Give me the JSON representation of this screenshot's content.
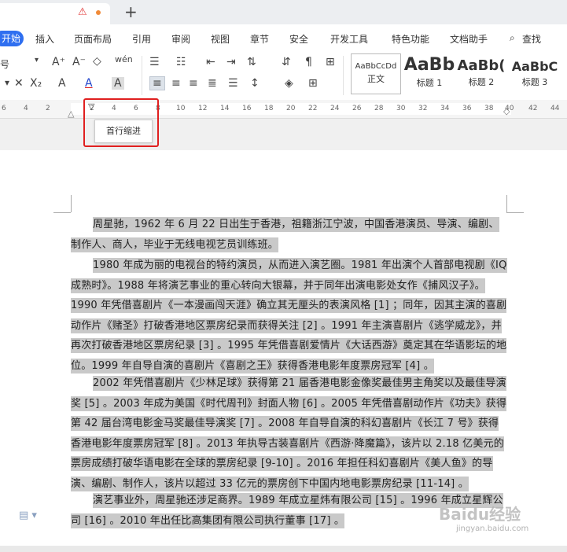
{
  "titlebar": {
    "warn_icon": "warning-icon",
    "new_tab": "+"
  },
  "menu": {
    "start": "开始",
    "items": [
      "插入",
      "页面布局",
      "引用",
      "审阅",
      "视图",
      "章节",
      "安全",
      "开发工具",
      "特色功能",
      "文档助手",
      "查找"
    ]
  },
  "toolbar": {
    "font_size_partial": "号",
    "grow_font": "A⁺",
    "shrink_font": "A⁻",
    "clear_format": "◇",
    "pinyin": "wén",
    "bullets": "☰",
    "numbering": "☷",
    "align_left": "≡",
    "align_center": "≡",
    "align_right": "≡",
    "font_color": "A",
    "highlight": "A"
  },
  "styles": [
    {
      "sample": "AaBbCcDd",
      "name": "正文"
    },
    {
      "sample": "AaBb",
      "name": "标题 1"
    },
    {
      "sample": "AaBb(",
      "name": "标题 2"
    },
    {
      "sample": "AaBbC",
      "name": "标题 3"
    }
  ],
  "ruler": {
    "numbers": [
      "6",
      "4",
      "2",
      "2",
      "4",
      "6",
      "8",
      "10",
      "12",
      "14",
      "16",
      "18",
      "20",
      "22",
      "24",
      "26",
      "28",
      "30",
      "32",
      "34",
      "36",
      "38",
      "40",
      "42",
      "44"
    ]
  },
  "tooltip": {
    "label": "首行缩进"
  },
  "document": {
    "p1": "周星驰，1962 年 6 月 22 日出生于香港，祖籍浙江宁波，中国香港演员、导演、编剧、制作人、商人，毕业于无线电视艺员训练班。",
    "p2": "1980 年成为丽的电视台的特约演员，从而进入演艺圈。1981 年出演个人首部电视剧《IQ 成熟时》。1988 年将演艺事业的重心转向大银幕，并于同年出演电影处女作《捕风汉子》。1990 年凭借喜剧片《一本漫画闯天涯》确立其无厘头的表演风格 [1] ；同年，因其主演的喜剧动作片《赌圣》打破香港地区票房纪录而获得关注 [2] 。1991 年主演喜剧片《逃学威龙》，并再次打破香港地区票房纪录 [3] 。1995 年凭借喜剧爱情片《大话西游》奠定其在华语影坛的地位。1999 年自导自演的喜剧片《喜剧之王》获得香港电影年度票房冠军 [4] 。",
    "p3": "2002 年凭借喜剧片《少林足球》获得第 21 届香港电影金像奖最佳男主角奖以及最佳导演奖 [5] 。2003 年成为美国《时代周刊》封面人物 [6] 。2005 年凭借喜剧动作片《功夫》获得第 42 届台湾电影金马奖最佳导演奖 [7] 。2008 年自导自演的科幻喜剧片《长江 7 号》获得香港电影年度票房冠军 [8] 。2013 年执导古装喜剧片《西游·降魔篇》，该片以 2.18 亿美元的票房成绩打破华语电影在全球的票房纪录 [9-10] 。2016 年担任科幻喜剧片《美人鱼》的导演、编剧、制作人，该片以超过 33 亿元的票房创下中国内地电影票房纪录 [11-14] 。",
    "p4": "演艺事业外，周星驰还涉足商界。1989 年成立星炜有限公司 [15] 。1996 年成立星辉公司 [16] 。2010 年出任比高集团有限公司执行董事 [17] 。"
  },
  "watermark": {
    "text": "Baidu经验",
    "sub": "jingyan.baidu.com"
  }
}
